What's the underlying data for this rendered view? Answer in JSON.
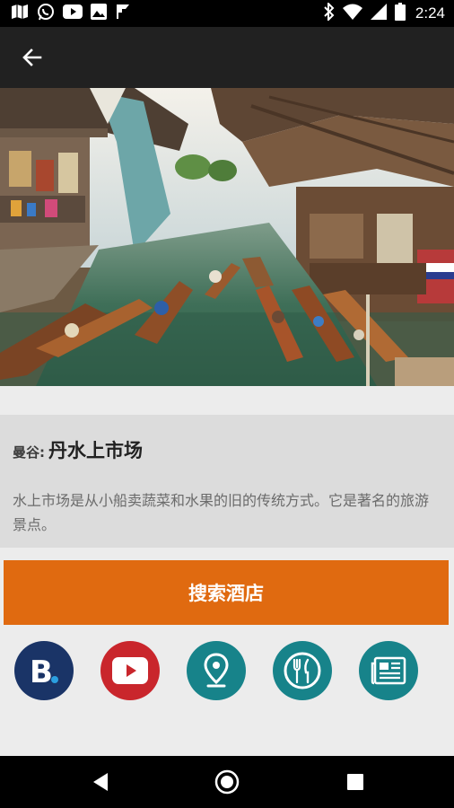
{
  "status_bar": {
    "time": "2:24",
    "left_icons": [
      "map-book-icon",
      "whatsapp-icon",
      "youtube-icon",
      "photo-icon",
      "flipboard-icon"
    ],
    "right_icons": [
      "bluetooth-icon",
      "wifi-icon",
      "signal-icon",
      "battery-icon"
    ]
  },
  "app_bar": {
    "back_icon": "arrow-back-icon"
  },
  "hero": {
    "image": "floating-market-photo"
  },
  "place": {
    "city": "曼谷:",
    "name": "丹水上市场",
    "description": "水上市场是从小船卖蔬菜和水果的旧的传统方式。它是著名的旅游景点。"
  },
  "actions": {
    "search_hotels_label": "搜索酒店",
    "buttons": [
      {
        "icon": "booking-icon",
        "color": "#1a3467"
      },
      {
        "icon": "youtube-play-icon",
        "color": "#c9262c"
      },
      {
        "icon": "map-pin-icon",
        "color": "#17838a"
      },
      {
        "icon": "restaurant-icon",
        "color": "#17838a"
      },
      {
        "icon": "newspaper-icon",
        "color": "#17838a"
      }
    ]
  },
  "nav_bar": {
    "icons": [
      "back-triangle-icon",
      "home-circle-icon",
      "recents-square-icon"
    ]
  }
}
